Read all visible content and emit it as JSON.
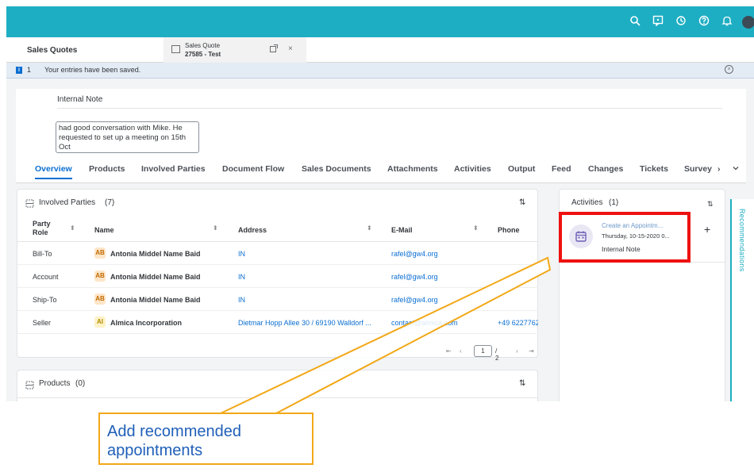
{
  "tabs": {
    "sales_quotes": "Sales Quotes",
    "doc_tab_line1": "Sales Quote",
    "doc_tab_line2": "27585 - Test",
    "close_glyph": "×"
  },
  "message_bar": {
    "count": "1",
    "text": "Your entries have been saved."
  },
  "note": {
    "label": "Internal Note",
    "value": "had good conversation with Mike. He requested to set up a meeting on 15th Oct"
  },
  "nav_tabs": [
    "Overview",
    "Products",
    "Involved Parties",
    "Document Flow",
    "Sales Documents",
    "Attachments",
    "Activities",
    "Output",
    "Feed",
    "Changes",
    "Tickets",
    "Survey"
  ],
  "nav_more": "›",
  "involved_parties": {
    "title": "Involved Parties",
    "count": "(7)",
    "columns": {
      "party_role_1": "Party",
      "party_role_2": "Role",
      "name": "Name",
      "address": "Address",
      "email": "E-Mail",
      "phone": "Phone"
    },
    "rows": [
      {
        "role": "Bill-To",
        "initials": "AB",
        "name": "Antonia Middel Name Baid",
        "address": "IN",
        "email": "rafel@gw4.org",
        "phone": ""
      },
      {
        "role": "Account",
        "initials": "AB",
        "name": "Antonia Middel Name Baid",
        "address": "IN",
        "email": "rafel@gw4.org",
        "phone": ""
      },
      {
        "role": "Ship-To",
        "initials": "AB",
        "name": "Antonia Middel Name Baid",
        "address": "IN",
        "email": "rafel@gw4.org",
        "phone": ""
      },
      {
        "role": "Seller",
        "initials": "AI",
        "name": "Almica Incorporation",
        "address": "Dietmar Hopp Allee 30 / 69190 Walldorf ...",
        "email": "contact@almica.com",
        "phone": "+49 6227762"
      }
    ],
    "pager": {
      "page": "1",
      "total": "/ 2"
    }
  },
  "products": {
    "title": "Products",
    "count": "(0)"
  },
  "activities": {
    "title": "Activities",
    "count": "(1)",
    "item": {
      "title": "Create an Appointm...",
      "date": "Thursday, 10-15-2020 0...",
      "note": "Internal Note"
    },
    "add_glyph": "+"
  },
  "recommendations_label": "Recommendations",
  "callout": {
    "line1": "Add recommended",
    "line2": "appointments"
  },
  "colors": {
    "shell_bar": "#1eaec3",
    "accent": "#0a6ed1",
    "highlight_box": "#ee1111",
    "callout_border": "#f2a818",
    "callout_text": "#1f5fb8"
  }
}
